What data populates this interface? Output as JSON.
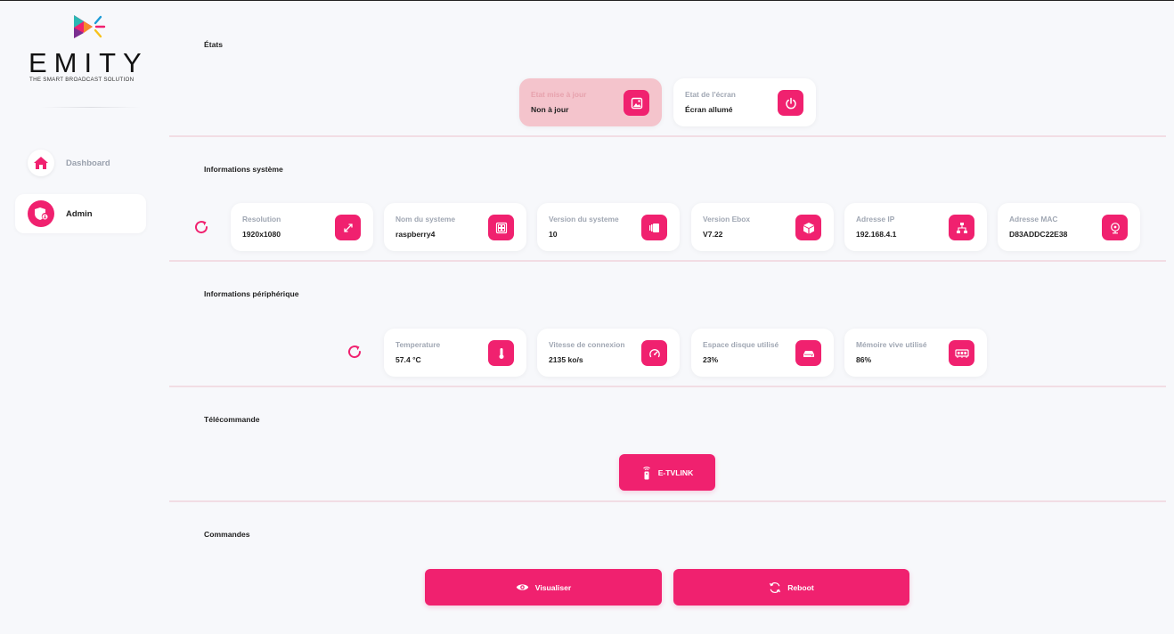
{
  "brand": {
    "name": "EMITY",
    "tagline": "THE SMART BROADCAST SOLUTION",
    "accent": "#f0216f"
  },
  "sidebar": {
    "items": [
      {
        "label": "Dashboard",
        "icon": "home-icon",
        "active": false
      },
      {
        "label": "Admin",
        "icon": "shield-user-icon",
        "active": true
      }
    ]
  },
  "sections": {
    "etats": {
      "title": "États",
      "cards": [
        {
          "label": "Etat mise à jour",
          "value": "Non à jour",
          "icon": "image-icon",
          "status": "warning"
        },
        {
          "label": "Etat de l'écran",
          "value": "Écran allumé",
          "icon": "power-icon",
          "status": "normal"
        }
      ]
    },
    "systeme": {
      "title": "Informations système",
      "cards": [
        {
          "label": "Resolution",
          "value": "1920x1080",
          "icon": "expand-icon"
        },
        {
          "label": "Nom du systeme",
          "value": "raspberry4",
          "icon": "board-icon"
        },
        {
          "label": "Version du systeme",
          "value": "10",
          "icon": "layers-icon"
        },
        {
          "label": "Version Ebox",
          "value": "V7.22",
          "icon": "box-icon"
        },
        {
          "label": "Adresse IP",
          "value": "192.168.4.1",
          "icon": "network-icon"
        },
        {
          "label": "Adresse MAC",
          "value": "D83ADDC22E38",
          "icon": "globe-icon"
        }
      ]
    },
    "peripherique": {
      "title": "Informations périphérique",
      "cards": [
        {
          "label": "Temperature",
          "value": "57.4 °C",
          "icon": "thermometer-icon"
        },
        {
          "label": "Vitesse de connexion",
          "value": "2135 ko/s",
          "icon": "speedometer-icon"
        },
        {
          "label": "Espace disque utilisé",
          "value": "23%",
          "icon": "hard-drive-icon"
        },
        {
          "label": "Mémoire vive utilisé",
          "value": "86%",
          "icon": "memory-icon"
        }
      ]
    },
    "telecommande": {
      "title": "Télécommande",
      "button": "E-TVLINK"
    },
    "commandes": {
      "title": "Commandes",
      "buttons": [
        "Visualiser",
        "Reboot"
      ]
    }
  }
}
